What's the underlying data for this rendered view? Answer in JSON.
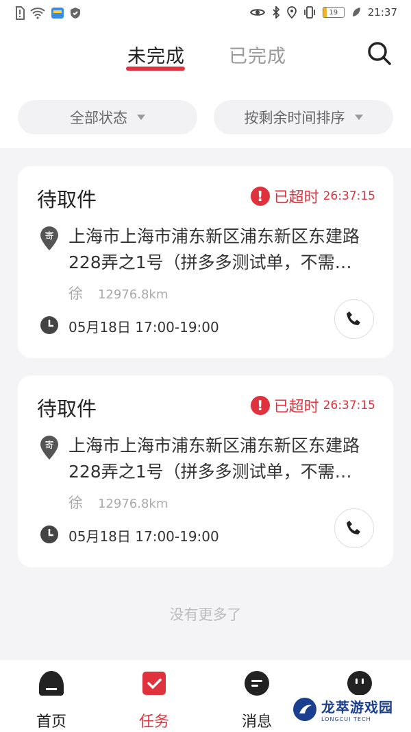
{
  "status_bar": {
    "time": "21:37",
    "battery": "19",
    "battery_level": 0.19
  },
  "tabs": [
    {
      "label": "未完成",
      "active": true
    },
    {
      "label": "已完成",
      "active": false
    }
  ],
  "filters": [
    {
      "label": "全部状态"
    },
    {
      "label": "按剩余时间排序"
    }
  ],
  "orders": [
    {
      "status": "待取件",
      "overdue_label": "已超时",
      "overdue_time": "26:37:15",
      "badge": "寄",
      "address": "上海市上海市浦东新区浦东新区东建路228弄之1号（拼多多测试单，不需…",
      "receiver_name": "徐",
      "distance": "12976.8km",
      "time_window": "05月18日 17:00-19:00"
    },
    {
      "status": "待取件",
      "overdue_label": "已超时",
      "overdue_time": "26:37:15",
      "badge": "寄",
      "address": "上海市上海市浦东新区浦东新区东建路228弄之1号（拼多多测试单，不需…",
      "receiver_name": "徐",
      "distance": "12976.8km",
      "time_window": "05月18日 17:00-19:00"
    }
  ],
  "no_more_text": "没有更多了",
  "bottom_nav": [
    {
      "label": "首页",
      "icon": "home-icon",
      "active": false
    },
    {
      "label": "任务",
      "icon": "task-check-icon",
      "active": true
    },
    {
      "label": "消息",
      "icon": "message-icon",
      "active": false
    }
  ],
  "watermark": {
    "main": "龙萃游戏园",
    "sub": "LONGCUI TECH"
  },
  "colors": {
    "accent": "#e0323c",
    "background": "#f4f4f6",
    "text": "#222222",
    "muted": "#999999"
  }
}
